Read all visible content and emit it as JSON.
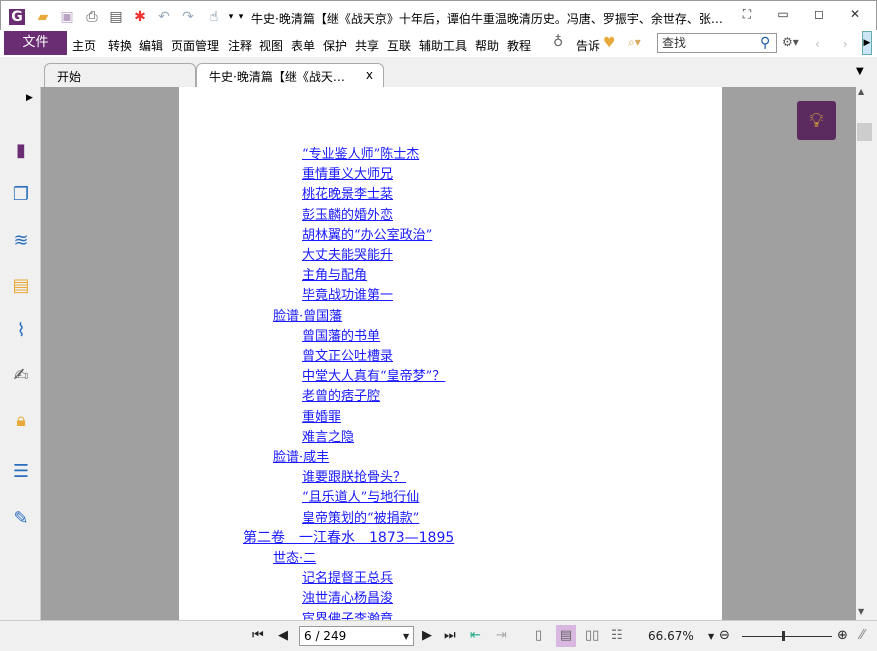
{
  "window": {
    "title": "牛史·晚清篇【继《战天京》十年后，谭伯牛重温晚清历史。冯唐、罗振宇、余世存、张…",
    "minimize": "▭",
    "restore": "◻",
    "close": "✕",
    "brand_color": "#6a2d73"
  },
  "quick_toolbar": [
    "app-logo-icon",
    "open-folder-icon",
    "save-icon",
    "print-icon",
    "properties-icon",
    "new-icon",
    "undo-icon",
    "redo-icon",
    "hand-tool-icon"
  ],
  "menu": {
    "file": "文件",
    "items": [
      "主页",
      "转换",
      "编辑",
      "页面管理",
      "注释",
      "视图",
      "表单",
      "保护",
      "共享",
      "互联",
      "辅助工具",
      "帮助",
      "教程"
    ],
    "tell": "告诉",
    "search_placeholder": "查找"
  },
  "tabs": [
    {
      "label": "开始"
    },
    {
      "label": "牛史·晚清篇【继《战天…",
      "close": "x"
    }
  ],
  "toc": [
    {
      "level": 3,
      "text": "“专业鉴人师”陈士杰"
    },
    {
      "level": 3,
      "text": "重情重义大师兄"
    },
    {
      "level": 3,
      "text": "桃花晚景李士棻"
    },
    {
      "level": 3,
      "text": "彭玉麟的婚外恋"
    },
    {
      "level": 3,
      "text": "胡林翼的“办公室政治”"
    },
    {
      "level": 3,
      "text": "大丈夫能哭能升"
    },
    {
      "level": 3,
      "text": "主角与配角"
    },
    {
      "level": 3,
      "text": "毕竟战功谁第一"
    },
    {
      "level": 2,
      "text": "脸谱·曾国藩"
    },
    {
      "level": 3,
      "text": "曾国藩的书单"
    },
    {
      "level": 3,
      "text": "曾文正公吐槽录"
    },
    {
      "level": 3,
      "text": "中堂大人真有“皇帝梦”？"
    },
    {
      "level": 3,
      "text": "老曾的痞子腔"
    },
    {
      "level": 3,
      "text": "重婚罪"
    },
    {
      "level": 3,
      "text": "难言之隐"
    },
    {
      "level": 2,
      "text": "脸谱·咸丰"
    },
    {
      "level": 3,
      "text": "谁要跟朕抢骨头？"
    },
    {
      "level": 3,
      "text": "“且乐道人”与地行仙"
    },
    {
      "level": 3,
      "text": "皇帝策划的“被捐款”"
    },
    {
      "level": 1,
      "text": "第二卷　一江春水　1873—1895"
    },
    {
      "level": 2,
      "text": "世态·二"
    },
    {
      "level": 3,
      "text": "记名提督王总兵"
    },
    {
      "level": 3,
      "text": "浊世清心杨昌浚"
    },
    {
      "level": 3,
      "text": "宦界佛子李瀚章"
    }
  ],
  "status": {
    "page": "6 / 249",
    "zoom": "66.67%",
    "zoom_level_fraction": 0.45
  }
}
